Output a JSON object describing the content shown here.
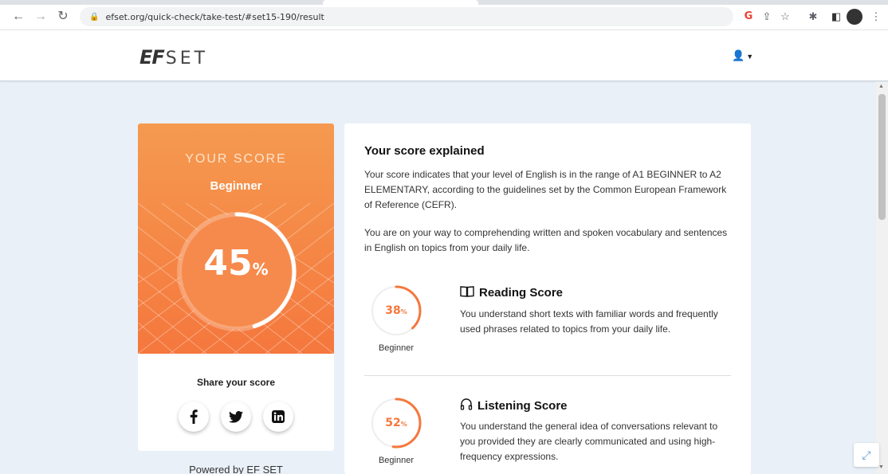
{
  "browser": {
    "url": "efset.org/quick-check/take-test/#set15-190/result"
  },
  "site": {
    "logo_ef": "EF",
    "logo_set": "SET"
  },
  "score_card": {
    "heading": "YOUR SCORE",
    "level": "Beginner",
    "percent": "45",
    "percent_sign": "%",
    "progress": 0.45,
    "share_title": "Share your score",
    "powered_by": "Powered by EF SET"
  },
  "explanation": {
    "title": "Your score explained",
    "paragraph1": "Your score indicates that your level of English is in the range of A1 BEGINNER to A2 ELEMENTARY, according to the guidelines set by the Common European Framework of Reference (CEFR).",
    "paragraph2": "You are on your way to comprehending written and spoken vocabulary and sentences in English on topics from your daily life.",
    "reading": {
      "title": "Reading Score",
      "percent": "38",
      "percent_sign": "%",
      "progress": 0.38,
      "level": "Beginner",
      "description": "You understand short texts with familiar words and frequently used phrases related to topics from your daily life."
    },
    "listening": {
      "title": "Listening Score",
      "percent": "52",
      "percent_sign": "%",
      "progress": 0.52,
      "level": "Beginner",
      "description": "You understand the general idea of conversations relevant to you provided they are clearly communicated and using high-frequency expressions."
    }
  },
  "colors": {
    "accent": "#f5773d",
    "card_gradient_top": "#f59a50",
    "page_bg": "#e9f0f8"
  }
}
